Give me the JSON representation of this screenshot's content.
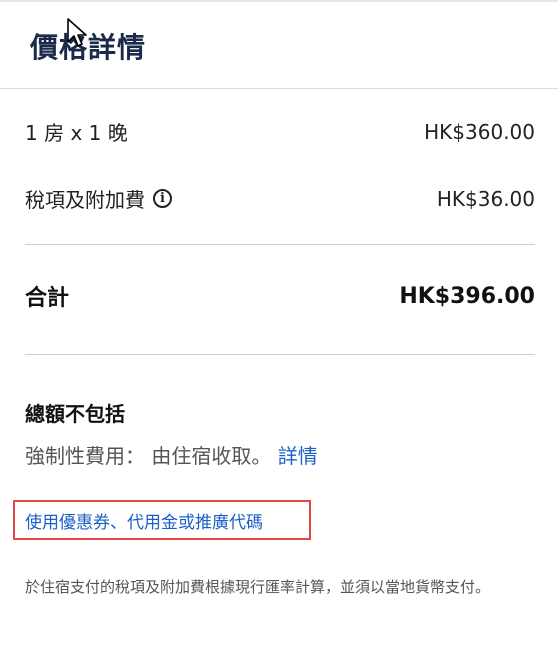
{
  "header": {
    "title": "價格詳情"
  },
  "price_rows": {
    "room": {
      "label": "1 房 x 1 晚",
      "value": "HK$360.00"
    },
    "tax": {
      "label": "稅項及附加費",
      "value": "HK$36.00",
      "icon": "info-icon"
    }
  },
  "total": {
    "label": "合計",
    "value": "HK$396.00"
  },
  "excluded": {
    "title": "總額不包括",
    "text": "強制性費用： 由住宿收取。",
    "details_link": "詳情"
  },
  "promo": {
    "link_label": "使用優惠券、代用金或推廣代碼"
  },
  "note": "於住宿支付的稅項及附加費根據現行匯率計算，並須以當地貨幣支付。",
  "colors": {
    "link": "#1a61c7",
    "highlight_border": "#e64545",
    "title": "#1b2a4a"
  }
}
